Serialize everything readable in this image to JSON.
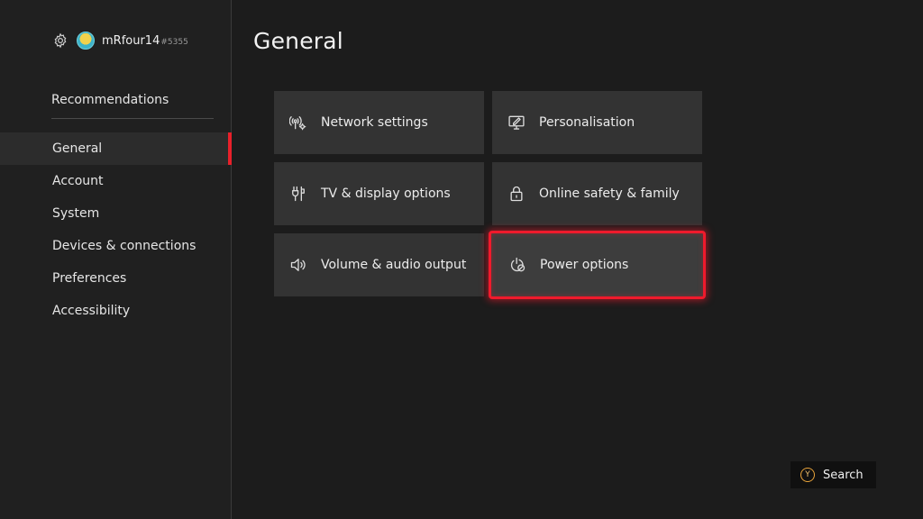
{
  "profile": {
    "gamertag": "mRfour14",
    "gamertag_suffix": "#5355",
    "icons": {
      "settings": "gear-icon",
      "avatar": "avatar"
    }
  },
  "sidebar": {
    "top_item": "Recommendations",
    "items": [
      {
        "label": "General",
        "active": true
      },
      {
        "label": "Account",
        "active": false
      },
      {
        "label": "System",
        "active": false
      },
      {
        "label": "Devices & connections",
        "active": false
      },
      {
        "label": "Preferences",
        "active": false
      },
      {
        "label": "Accessibility",
        "active": false
      }
    ]
  },
  "main": {
    "title": "General",
    "tiles": [
      {
        "label": "Network settings",
        "icon": "network-icon"
      },
      {
        "label": "Personalisation",
        "icon": "personalisation-icon"
      },
      {
        "label": "TV & display options",
        "icon": "tv-display-icon"
      },
      {
        "label": "Online safety & family",
        "icon": "lock-icon"
      },
      {
        "label": "Volume & audio output",
        "icon": "speaker-icon"
      },
      {
        "label": "Power options",
        "icon": "power-icon",
        "focused": true
      }
    ]
  },
  "footer": {
    "search_button_glyph": "Y",
    "search_label": "Search"
  },
  "colors": {
    "background": "#1c1c1c",
    "sidebar": "#202020",
    "tile": "#333333",
    "focus_accent": "#f01a2c",
    "active_indicator": "#e8202a",
    "y_button": "#e8a33a"
  }
}
